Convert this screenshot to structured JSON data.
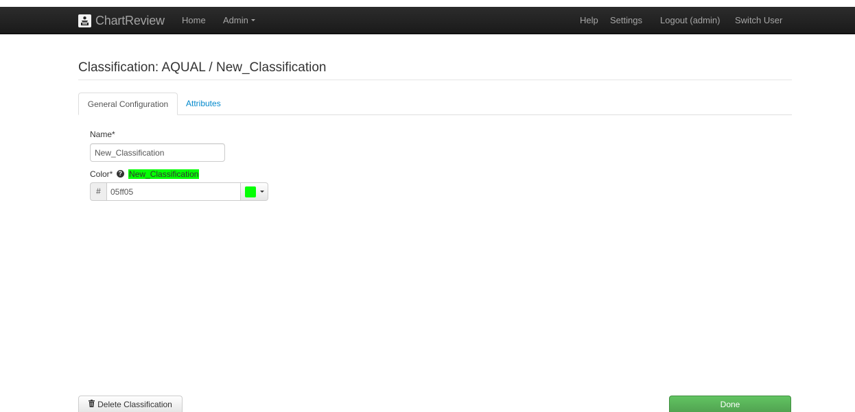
{
  "navbar": {
    "brand": "ChartReview",
    "brand_icon": "chartreview-logo-icon",
    "left_links": {
      "home": "Home",
      "admin": "Admin"
    },
    "right_links": {
      "help": "Help",
      "settings": "Settings",
      "logout": "Logout (admin)",
      "switch_user": "Switch User"
    }
  },
  "page": {
    "title": "Classification: AQUAL / New_Classification"
  },
  "tabs": {
    "general": "General Configuration",
    "attributes": "Attributes",
    "active": "General Configuration"
  },
  "form": {
    "name_label": "Name*",
    "name_value": "New_Classification",
    "color_label": "Color*",
    "color_preview_text": "New_Classification",
    "color_prefix": "#",
    "color_value": "05ff05",
    "color_hex": "#05ff05",
    "help_icon": "question-circle-icon"
  },
  "footer": {
    "delete_label": "Delete Classification",
    "delete_icon": "trash-icon",
    "done_label": "Done"
  },
  "colors": {
    "navbar_bg": "#1b1b1b",
    "link": "#0088cc",
    "done_green": "#5bb75b",
    "selected_color": "#05ff05"
  }
}
